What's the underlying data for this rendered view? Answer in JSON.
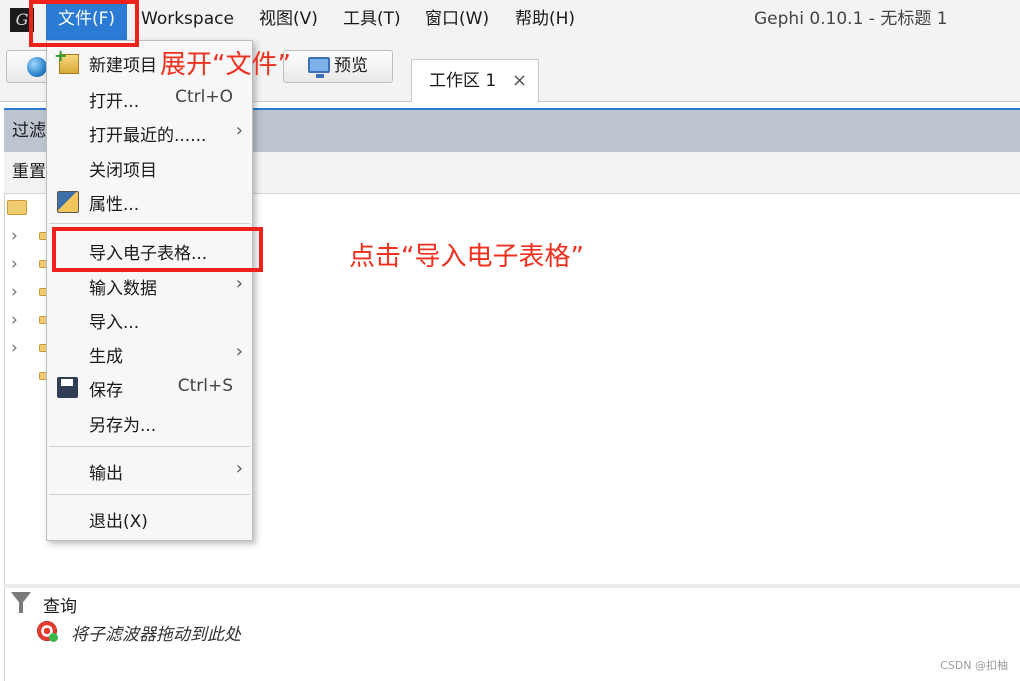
{
  "menubar": {
    "items": [
      "文件(F)",
      "Workspace",
      "视图(V)",
      "工具(T)",
      "窗口(W)",
      "帮助(H)"
    ],
    "window_title": "Gephi 0.10.1 - 无标题 1"
  },
  "toolbar": {
    "preview_label": "预览",
    "workspace_tab": "工作区 1",
    "tab_close": "×"
  },
  "left_panel": {
    "filter_header": "过滤",
    "reset_label": "重置"
  },
  "query": {
    "label": "查询",
    "drop_hint": "将子滤波器拖动到此处"
  },
  "file_menu": {
    "new_project": "新建项目",
    "open": "打开...",
    "open_shortcut": "Ctrl+O",
    "open_recent": "打开最近的......",
    "close_project": "关闭项目",
    "properties": "属性...",
    "import_spreadsheet": "导入电子表格...",
    "input_data": "输入数据",
    "import": "导入...",
    "generate": "生成",
    "save": "保存",
    "save_shortcut": "Ctrl+S",
    "save_as": "另存为...",
    "export": "输出",
    "exit": "退出(X)"
  },
  "annotations": {
    "expand_note": "展开“文件”",
    "click_note": "点击“导入电子表格”",
    "highlight_color": "#f0201a"
  },
  "colors": {
    "menu_active": "#2b7bd5",
    "filter_header_bg": "#bcc5cf"
  },
  "watermark": "CSDN @扣柚"
}
